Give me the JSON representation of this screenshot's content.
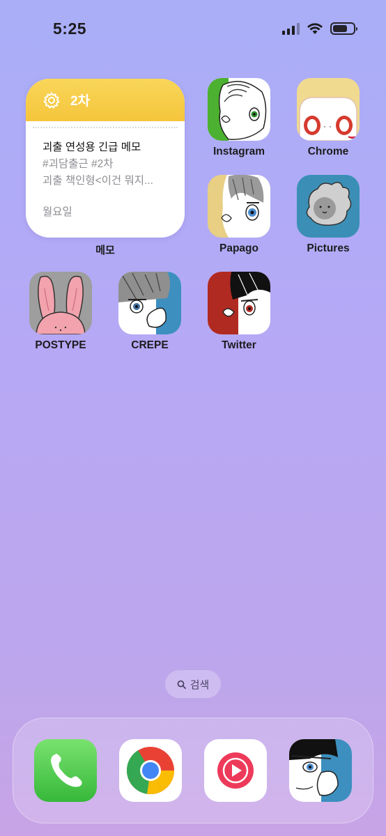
{
  "status_bar": {
    "time": "5:25"
  },
  "notes_widget": {
    "title": "2차",
    "note_title": "괴출 연성용 긴급 메모",
    "note_line1": "#괴담출근 #2차",
    "note_line2": "괴출 책인형<이건 뭐지...",
    "note_date": "월요일",
    "label": "메모",
    "accent": "#f7cd46"
  },
  "apps": [
    {
      "label": "Instagram",
      "icon": "instagram-icon"
    },
    {
      "label": "Chrome",
      "icon": "chrome-icon"
    },
    {
      "label": "Papago",
      "icon": "papago-icon"
    },
    {
      "label": "Pictures",
      "icon": "pictures-icon"
    },
    {
      "label": "POSTYPE",
      "icon": "postype-icon"
    },
    {
      "label": "CREPE",
      "icon": "crepe-icon"
    },
    {
      "label": "Twitter",
      "icon": "twitter-icon"
    }
  ],
  "search": {
    "label": "검색"
  },
  "dock": [
    {
      "icon": "phone-icon"
    },
    {
      "icon": "chrome-browser-icon"
    },
    {
      "icon": "youtube-music-icon"
    },
    {
      "icon": "character-icon"
    }
  ],
  "colors": {
    "background_top": "#a9aef7",
    "background_bottom": "#c8a4e6"
  }
}
